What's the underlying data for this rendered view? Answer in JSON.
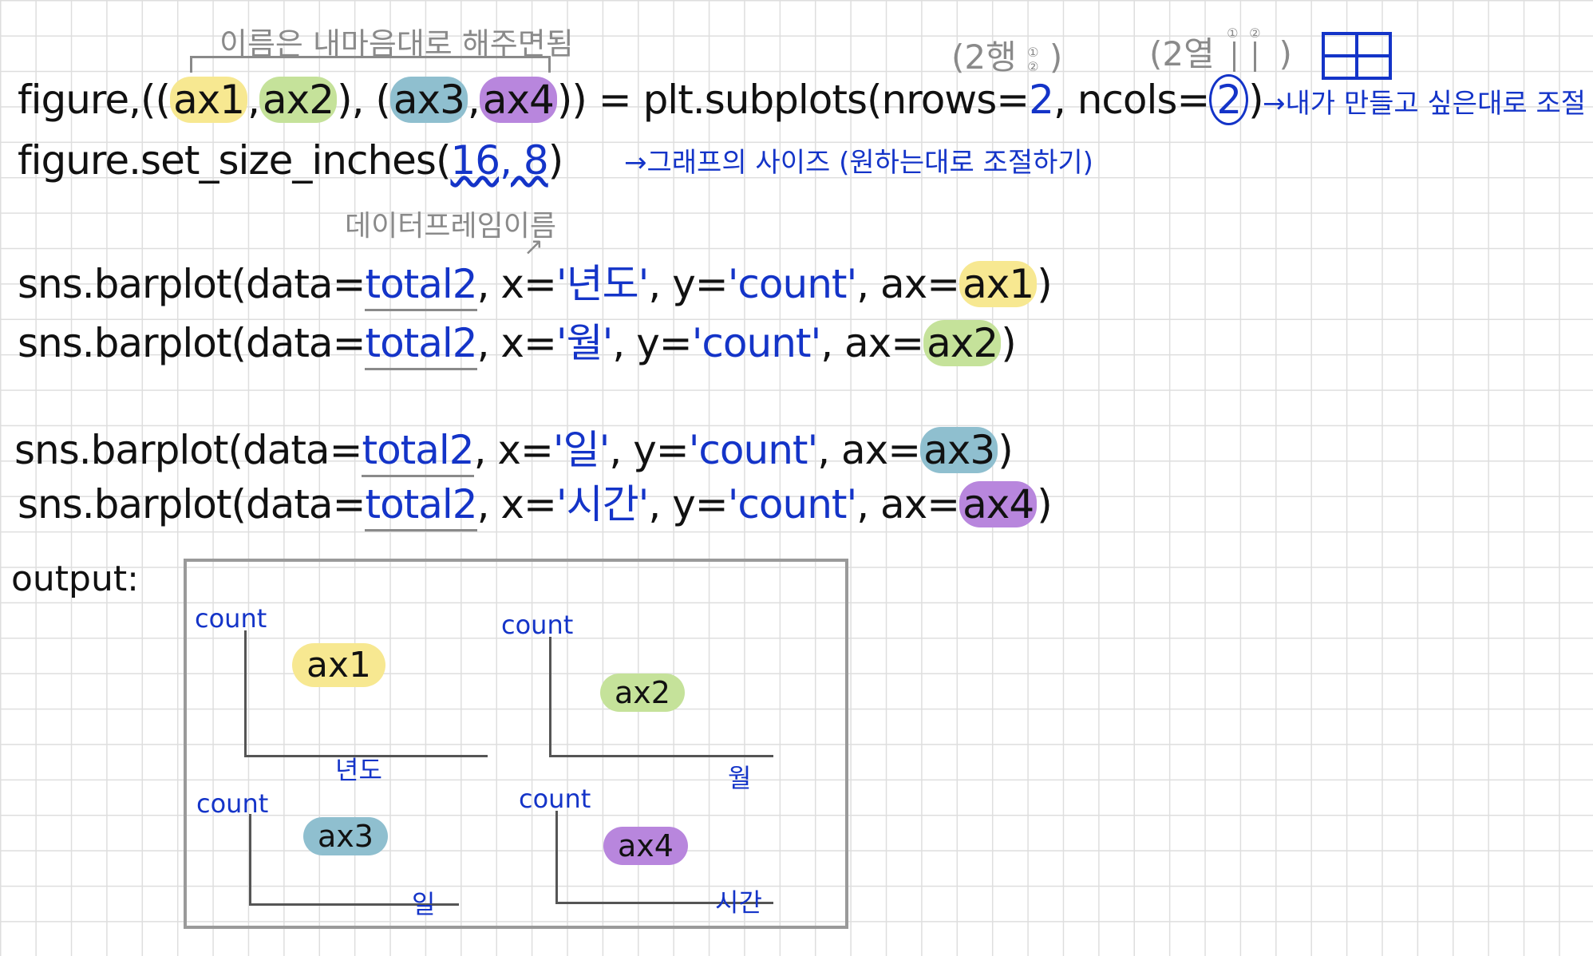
{
  "annotations": {
    "naming_note": "이름은 내마음대로 해주면됨",
    "rows_note": "(2행",
    "rows_closing": ")",
    "cols_note": "(2열",
    "cols_closing": ")",
    "marker_1": "①",
    "marker_2": "②",
    "ncols_note": "내가 만들고 싶은대로 조절",
    "size_note": "그래프의 사이즈 (원하는대로 조절하기)",
    "dataframe_note": "데이터프레임이름"
  },
  "code": {
    "line1": {
      "prefix": "figure,((",
      "ax1": "ax1",
      "comma1": ",",
      "ax2": "ax2",
      "mid": "), (",
      "ax3": "ax3",
      "comma2": ",",
      "ax4": "ax4",
      "eq": ")) = plt.subplots(nrows=",
      "nrows": "2",
      "sep": ", ncols=",
      "ncols": "2",
      "close": ")"
    },
    "line2": {
      "prefix": "figure.set_size_inches(",
      "size": "16, 8",
      "close": ")"
    },
    "barplots": [
      {
        "prefix": "sns.barplot(data=",
        "data": "total2",
        "xpart": ", x=",
        "x": "'년도'",
        "ypart": ", y=",
        "y": "'count'",
        "axpart": ", ax=",
        "ax": "ax1",
        "close": ")"
      },
      {
        "prefix": "sns.barplot(data=",
        "data": "total2",
        "xpart": ", x=",
        "x": "'월'",
        "ypart": ", y=",
        "y": "'count'",
        "axpart": ", ax=",
        "ax": "ax2",
        "close": ")"
      },
      {
        "prefix": "sns.barplot(data=",
        "data": "total2",
        "xpart": ", x=",
        "x": "'일'",
        "ypart": ", y=",
        "y": "'count'",
        "axpart": ", ax=",
        "ax": "ax3",
        "close": ")"
      },
      {
        "prefix": "sns.barplot(data=",
        "data": "total2",
        "xpart": ", x=",
        "x": "'시간'",
        "ypart": ", y=",
        "y": "'count'",
        "axpart": ", ax=",
        "ax": "ax4",
        "close": ")"
      }
    ]
  },
  "output": {
    "label": "output:",
    "panels": [
      {
        "name": "ax1",
        "ylabel": "count",
        "xlabel": "년도",
        "color": "#f7e891"
      },
      {
        "name": "ax2",
        "ylabel": "count",
        "xlabel": "월",
        "color": "#c5e29a"
      },
      {
        "name": "ax3",
        "ylabel": "count",
        "xlabel": "일",
        "color": "#8fbfcf"
      },
      {
        "name": "ax4",
        "ylabel": "count",
        "xlabel": "시간",
        "color": "#b886dd"
      }
    ]
  },
  "colors": {
    "ink": "#111111",
    "annotation_blue": "#1434c8",
    "annotation_gray": "#8a8a8a",
    "highlight_yellow": "#f7e891",
    "highlight_green": "#c5e29a",
    "highlight_blue": "#8fbfcf",
    "highlight_purple": "#b886dd"
  }
}
